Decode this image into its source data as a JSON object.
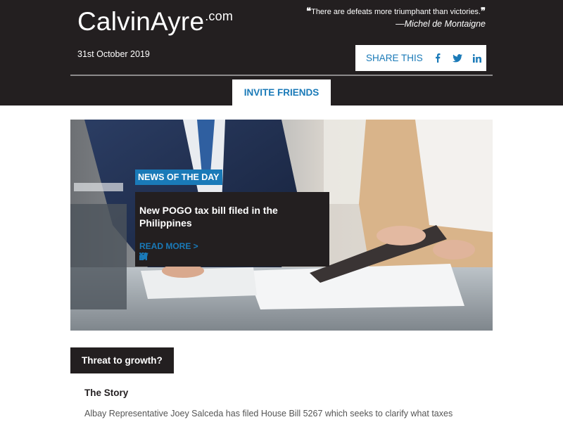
{
  "header": {
    "logo_main": "CalvinAyre",
    "logo_suffix": ".com",
    "quote_text": "There are defeats more triumphant than victories.",
    "quote_open": "❝",
    "quote_close": "❞",
    "quote_author": "—Michel de Montaigne",
    "date": "31st October 2019",
    "share_label": "SHARE THIS",
    "invite_label": "INVITE FRIENDS"
  },
  "hero": {
    "tag": "NEWS OF THE DAY",
    "title": "New POGO tax bill filed in the Philippines",
    "read_more": "READ MORE >"
  },
  "section": {
    "heading": "Threat to growth?",
    "story_heading": "The Story",
    "story_text": "Albay Representative Joey Salceda has filed House Bill 5267 which seeks to clarify what taxes"
  },
  "icons": {
    "facebook": "facebook-icon",
    "twitter": "twitter-icon",
    "linkedin": "linkedin-icon"
  },
  "colors": {
    "header_bg": "#231f20",
    "accent_blue": "#1a7ab8",
    "white": "#ffffff"
  }
}
